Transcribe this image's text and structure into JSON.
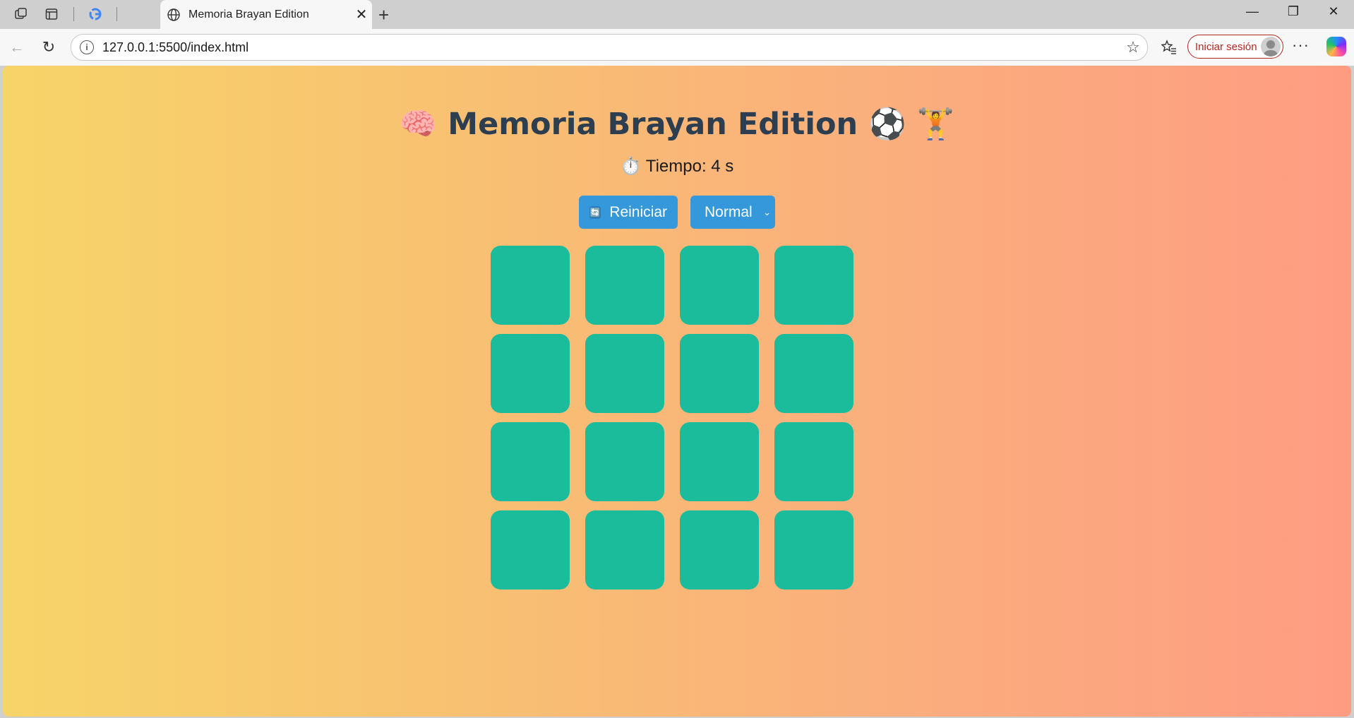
{
  "browser": {
    "tab_title": "Memoria Brayan Edition",
    "url": "127.0.0.1:5500/index.html",
    "signin_label": "Iniciar sesión"
  },
  "game": {
    "title": "🧠 Memoria Brayan Edition ⚽ 🏋️",
    "timer": "⏱️ Tiempo: 4 s",
    "restart_label": "Reiniciar",
    "restart_icon": "🔄",
    "difficulty_value": "Normal",
    "cards_count": 16,
    "card_color": "#1abc9c",
    "button_color": "#3498db",
    "title_color": "#2c3e50"
  }
}
